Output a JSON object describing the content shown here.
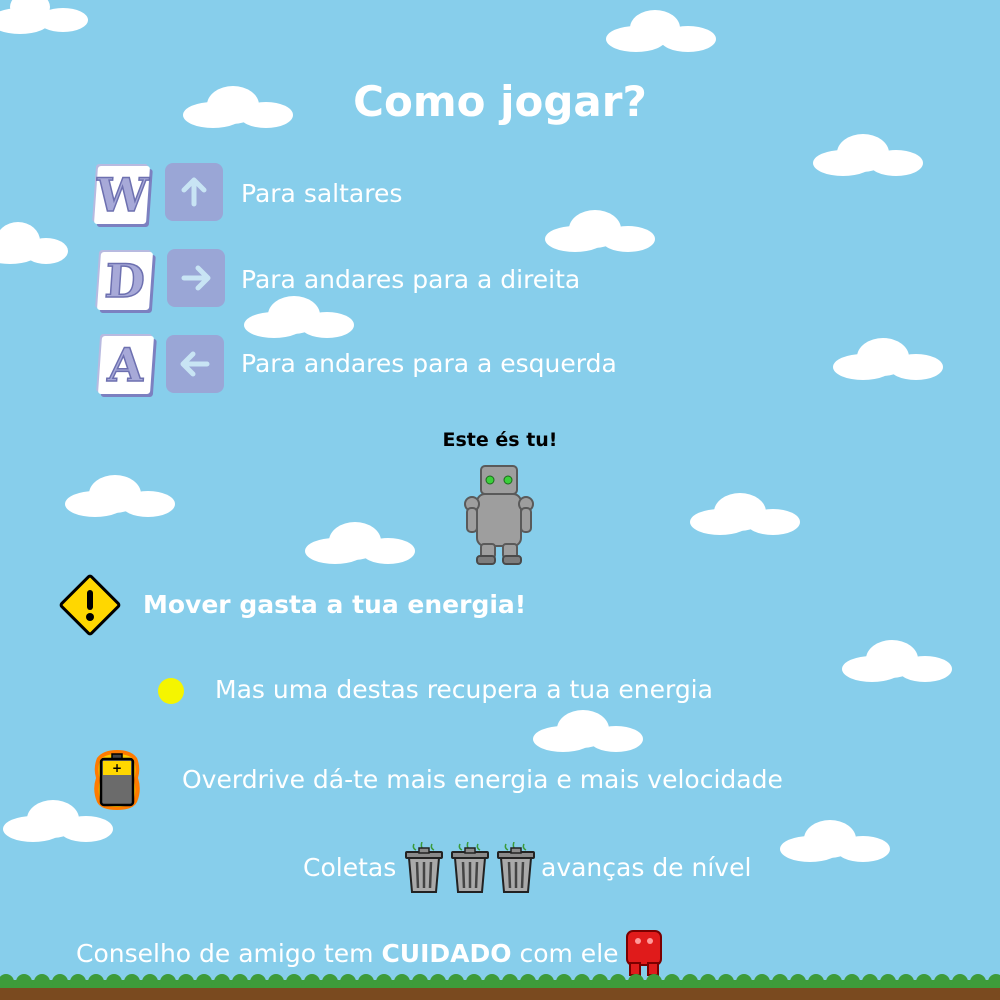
{
  "page": {
    "title": "Como jogar?",
    "controls": [
      {
        "key": "W",
        "arrow": "arrow-up-icon",
        "label": "Para saltares"
      },
      {
        "key": "D",
        "arrow": "arrow-right-icon",
        "label": "Para andares para a direita"
      },
      {
        "key": "A",
        "arrow": "arrow-left-icon",
        "label": "Para andares para a esquerda"
      }
    ],
    "player_caption": "Este és tu!",
    "warning_text": "Mover gasta a tua energia!",
    "energy_orb_text": "Mas uma destas recupera a tua energia",
    "overdrive_text": "Overdrive dá-te mais energia e mais velocidade",
    "collect_prefix": "Coletas",
    "collect_suffix": "avanças de nível",
    "advice_prefix": "Conselho de amigo tem",
    "advice_emphasis": "CUIDADO",
    "advice_suffix": "com ele"
  },
  "icons": {
    "warning": "warning-sign-icon",
    "energy_orb": "yellow-orb-icon",
    "battery": "overdrive-battery-icon",
    "trash": "trash-can-icon",
    "enemy": "red-enemy-icon",
    "player": "robot-player-icon"
  },
  "colors": {
    "sky": "#87ceeb",
    "text": "#ffffff",
    "key_arrow_bg": "#9aa6d6",
    "warning_yellow": "#ffd700",
    "orb_yellow": "#f5f500",
    "enemy_red": "#e01b1b",
    "grass": "#3e9b3a",
    "dirt": "#7a4a1f"
  }
}
